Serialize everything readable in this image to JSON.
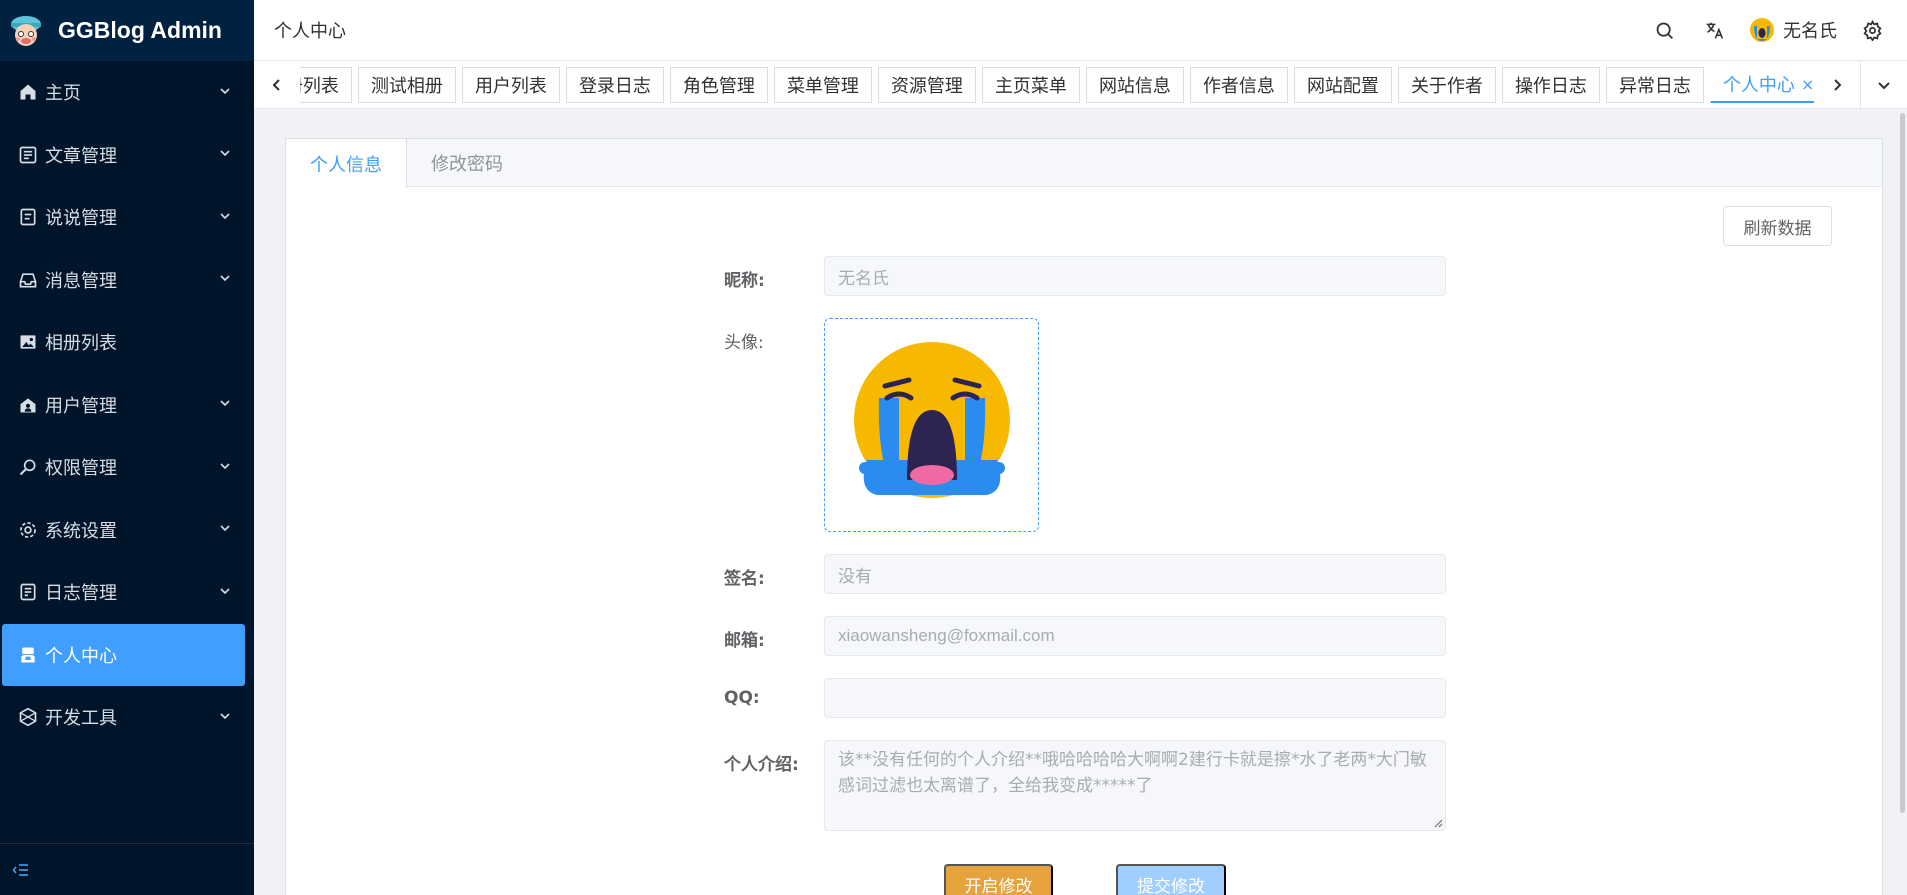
{
  "app": {
    "title": "GGBlog Admin"
  },
  "sidebar": {
    "items": [
      {
        "label": "主页",
        "icon": "home-icon",
        "has_arrow": true
      },
      {
        "label": "文章管理",
        "icon": "article-icon",
        "has_arrow": true
      },
      {
        "label": "说说管理",
        "icon": "talk-icon",
        "has_arrow": true
      },
      {
        "label": "消息管理",
        "icon": "message-icon",
        "has_arrow": true
      },
      {
        "label": "相册列表",
        "icon": "picture-icon",
        "has_arrow": false
      },
      {
        "label": "用户管理",
        "icon": "user-icon",
        "has_arrow": true
      },
      {
        "label": "权限管理",
        "icon": "permission-icon",
        "has_arrow": true
      },
      {
        "label": "系统设置",
        "icon": "settings-icon",
        "has_arrow": true
      },
      {
        "label": "日志管理",
        "icon": "log-icon",
        "has_arrow": true
      },
      {
        "label": "个人中心",
        "icon": "profile-icon",
        "has_arrow": false,
        "active": true
      },
      {
        "label": "开发工具",
        "icon": "devtools-icon",
        "has_arrow": true
      }
    ]
  },
  "header": {
    "breadcrumb": "个人中心",
    "user_name": "无名氏"
  },
  "tabs": {
    "items": [
      "册列表",
      "测试相册",
      "用户列表",
      "登录日志",
      "角色管理",
      "菜单管理",
      "资源管理",
      "主页菜单",
      "网站信息",
      "作者信息",
      "网站配置",
      "关于作者",
      "操作日志",
      "异常日志",
      "个人中心"
    ],
    "active_index": 14,
    "close_glyph": "×"
  },
  "card": {
    "tabs": [
      "个人信息",
      "修改密码"
    ],
    "active_tab": 0,
    "refresh_label": "刷新数据"
  },
  "form": {
    "nickname_label": "昵称:",
    "nickname_value": "无名氏",
    "avatar_label": "头像:",
    "signature_label": "签名:",
    "signature_value": "没有",
    "email_label": "邮箱:",
    "email_value": "xiaowansheng@foxmail.com",
    "qq_label": "QQ:",
    "qq_value": "",
    "intro_label": "个人介绍:",
    "intro_value": "该**没有任何的个人介绍**哦哈哈哈哈大啊啊2建行卡就是擦*水了老两*大门敏感词过滤也太离谱了，全给我变成*****了",
    "edit_button": "开启修改",
    "submit_button": "提交修改"
  },
  "colors": {
    "sidebar_bg": "#001529",
    "accent": "#409eff",
    "warning": "#e6a23c"
  }
}
